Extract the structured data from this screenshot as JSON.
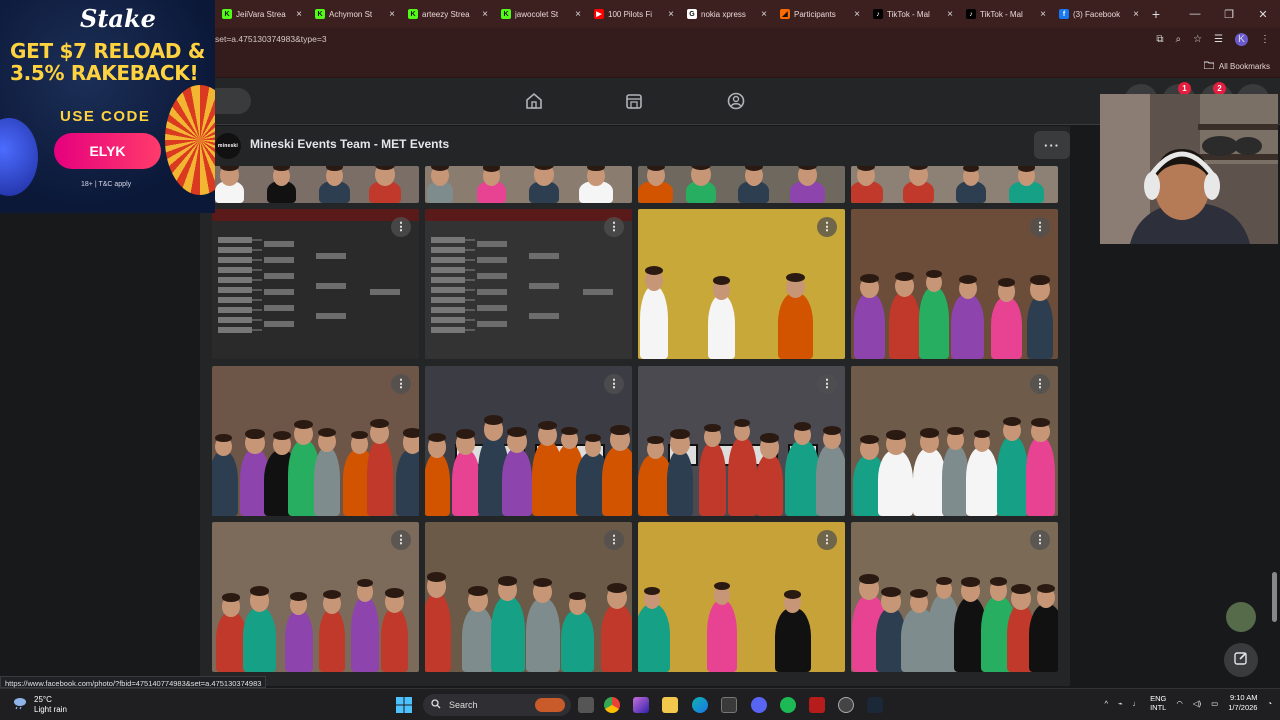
{
  "browser": {
    "tabs": [
      {
        "label": "JeiiVara Strea",
        "fav_color": "#53fc18",
        "fav_text": "K"
      },
      {
        "label": "Achymon St",
        "fav_color": "#53fc18",
        "fav_text": "K"
      },
      {
        "label": "arteezy Strea",
        "fav_color": "#53fc18",
        "fav_text": "K"
      },
      {
        "label": "jawocolet St",
        "fav_color": "#53fc18",
        "fav_text": "K"
      },
      {
        "label": "100 Pilots Fi",
        "fav_color": "#ff0000",
        "fav_text": "▶"
      },
      {
        "label": "nokia xpress",
        "fav_color": "#ffffff",
        "fav_text": "G"
      },
      {
        "label": "Participants",
        "fav_color": "#ff6a00",
        "fav_text": "◢"
      },
      {
        "label": "TikTok - Mal",
        "fav_color": "#000000",
        "fav_text": "♪"
      },
      {
        "label": "TikTok - Mal",
        "fav_color": "#000000",
        "fav_text": "♪"
      },
      {
        "label": "(3) Facebook",
        "fav_color": "#1877f2",
        "fav_text": "f"
      }
    ],
    "tab_close": "×",
    "new_tab": "+",
    "url": "set=a.475130374983&type=3",
    "all_bookmarks": "All Bookmarks",
    "profile_initial": "K"
  },
  "facebook": {
    "notifications_badge": "1",
    "messages_badge": "2",
    "album_logo_text": "mineski",
    "album_title": "Mineski Events Team - MET Events",
    "more_label": "···",
    "photo_menu": "⋮",
    "photos": [
      {
        "scene": "crowd",
        "bg": "#7a6e66"
      },
      {
        "scene": "crowd",
        "bg": "#8a7d70"
      },
      {
        "scene": "crowd",
        "bg": "#6f685e"
      },
      {
        "scene": "crowd",
        "bg": "#8d8074"
      },
      {
        "scene": "bracket",
        "bg": "#2a2a2a"
      },
      {
        "scene": "bracket",
        "bg": "#333333"
      },
      {
        "scene": "yellow",
        "bg": "#c9a83a"
      },
      {
        "scene": "group",
        "bg": "#6b4d3a"
      },
      {
        "scene": "group",
        "bg": "#6d5648"
      },
      {
        "scene": "lan",
        "bg": "#3c3c44"
      },
      {
        "scene": "lan",
        "bg": "#4a4a50"
      },
      {
        "scene": "group",
        "bg": "#6e5b4a"
      },
      {
        "scene": "group",
        "bg": "#7c6a5a"
      },
      {
        "scene": "group",
        "bg": "#6b5a48"
      },
      {
        "scene": "yellow",
        "bg": "#c7a238"
      },
      {
        "scene": "group",
        "bg": "#7a6a56"
      }
    ]
  },
  "ad": {
    "brand": "Stake",
    "headline": "GET $7 RELOAD & 3.5% RAKEBACK!",
    "use_code": "USE CODE",
    "code": "ELYK",
    "fine_print": "18+ | T&C apply"
  },
  "status_link": "https://www.facebook.com/photo/?fbid=475140774983&set=a.475130374983",
  "taskbar": {
    "temp": "25°C",
    "weather": "Light rain",
    "search_label": "Search",
    "lang_top": "ENG",
    "lang_bottom": "INTL",
    "time": "9:10 AM",
    "date": "1/7/2026"
  }
}
